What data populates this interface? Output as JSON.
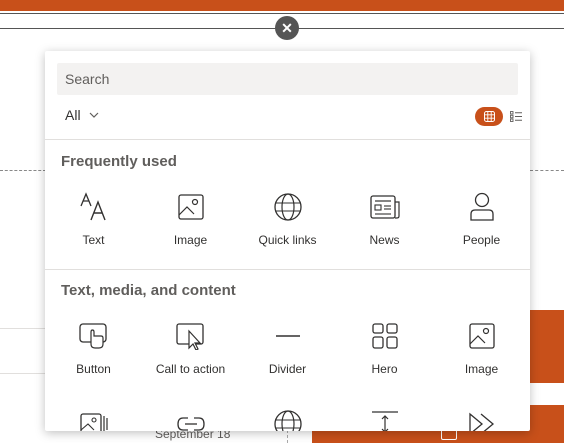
{
  "panel": {
    "search": {
      "placeholder": "Search"
    },
    "filter": {
      "label": "All"
    },
    "sections": [
      {
        "title": "Frequently used",
        "items": [
          {
            "label": "Text",
            "icon": "text-icon"
          },
          {
            "label": "Image",
            "icon": "image-icon"
          },
          {
            "label": "Quick links",
            "icon": "globe-icon"
          },
          {
            "label": "News",
            "icon": "news-icon"
          },
          {
            "label": "People",
            "icon": "person-icon"
          }
        ]
      },
      {
        "title": "Text, media, and content",
        "items": [
          {
            "label": "Button",
            "icon": "button-icon"
          },
          {
            "label": "Call to action",
            "icon": "call-to-action-icon"
          },
          {
            "label": "Divider",
            "icon": "divider-icon"
          },
          {
            "label": "Hero",
            "icon": "hero-icon"
          },
          {
            "label": "Image",
            "icon": "image-icon"
          }
        ]
      }
    ],
    "partial_row_icons": [
      "image-gallery-icon",
      "link-icon",
      "globe-icon",
      "spacer-icon",
      "stream-icon"
    ]
  },
  "background": {
    "date_label": "September 18"
  },
  "colors": {
    "accent": "#c8501a",
    "close_button": "#555555",
    "search_bg": "#f3f2f1"
  }
}
